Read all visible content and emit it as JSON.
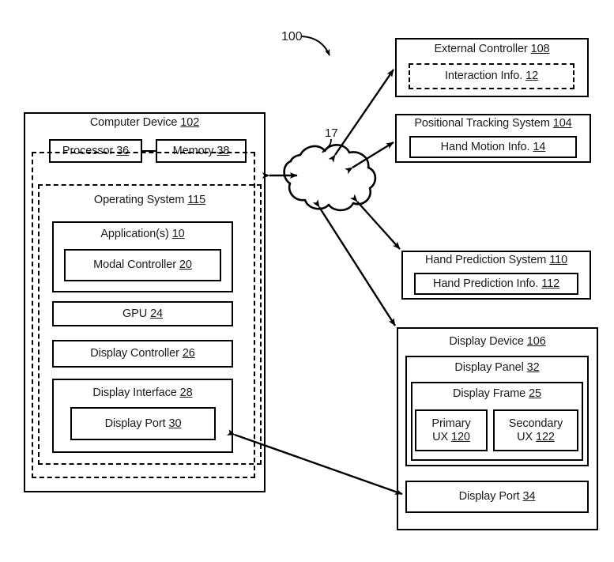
{
  "figure": {
    "ref_number": "100",
    "network": {
      "label": "Network",
      "ref": "17"
    }
  },
  "computer_device": {
    "title": "Computer Device",
    "ref": "102",
    "processor": {
      "title": "Processor",
      "ref": "36"
    },
    "memory": {
      "title": "Memory",
      "ref": "38"
    },
    "operating_system": {
      "title": "Operating System",
      "ref": "115"
    },
    "applications": {
      "title": "Application(s)",
      "ref": "10"
    },
    "modal_controller": {
      "title": "Modal Controller",
      "ref": "20"
    },
    "gpu": {
      "title": "GPU",
      "ref": "24"
    },
    "display_controller": {
      "title": "Display Controller",
      "ref": "26"
    },
    "display_interface": {
      "title": "Display Interface",
      "ref": "28"
    },
    "display_port": {
      "title": "Display Port",
      "ref": "30"
    }
  },
  "external_controller": {
    "title": "External Controller",
    "ref": "108",
    "interaction_info": {
      "title": "Interaction Info.",
      "ref": "12"
    }
  },
  "positional_tracking_system": {
    "title": "Positional Tracking System",
    "ref": "104",
    "hand_motion_info": {
      "title": "Hand Motion Info.",
      "ref": "14"
    }
  },
  "hand_prediction_system": {
    "title": "Hand Prediction System",
    "ref": "110",
    "hand_prediction_info": {
      "title": "Hand Prediction Info.",
      "ref": "112"
    }
  },
  "display_device": {
    "title": "Display Device",
    "ref": "106",
    "display_panel": {
      "title": "Display Panel",
      "ref": "32"
    },
    "display_frame": {
      "title": "Display Frame",
      "ref": "25"
    },
    "primary_ux": {
      "line1": "Primary",
      "line2": "UX",
      "ref": "120"
    },
    "secondary_ux": {
      "line1": "Secondary",
      "line2": "UX",
      "ref": "122"
    },
    "display_port": {
      "title": "Display Port",
      "ref": "34"
    }
  },
  "colors": {
    "stroke": "#000000",
    "text": "#1a1a1a",
    "background": "#ffffff"
  }
}
